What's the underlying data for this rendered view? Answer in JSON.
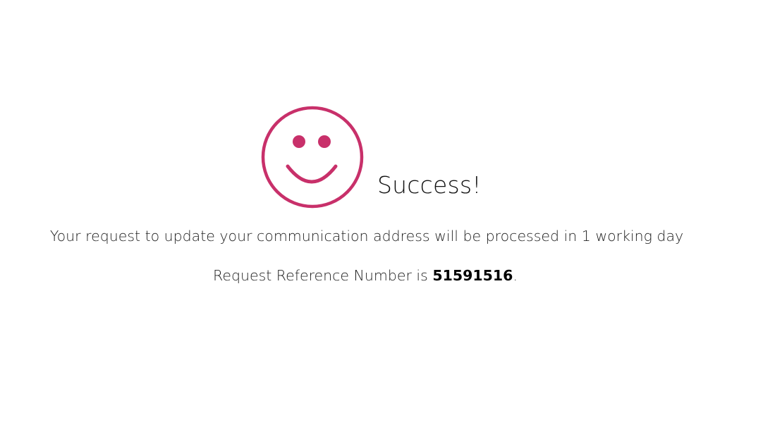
{
  "success": {
    "icon": "smiley-face-icon",
    "icon_color": "#c8306a",
    "title": "Success!",
    "message": "Your request to update your communication address will be processed in 1 working day",
    "reference_prefix": "Request Reference Number is ",
    "reference_number": "51591516",
    "reference_suffix": "."
  }
}
